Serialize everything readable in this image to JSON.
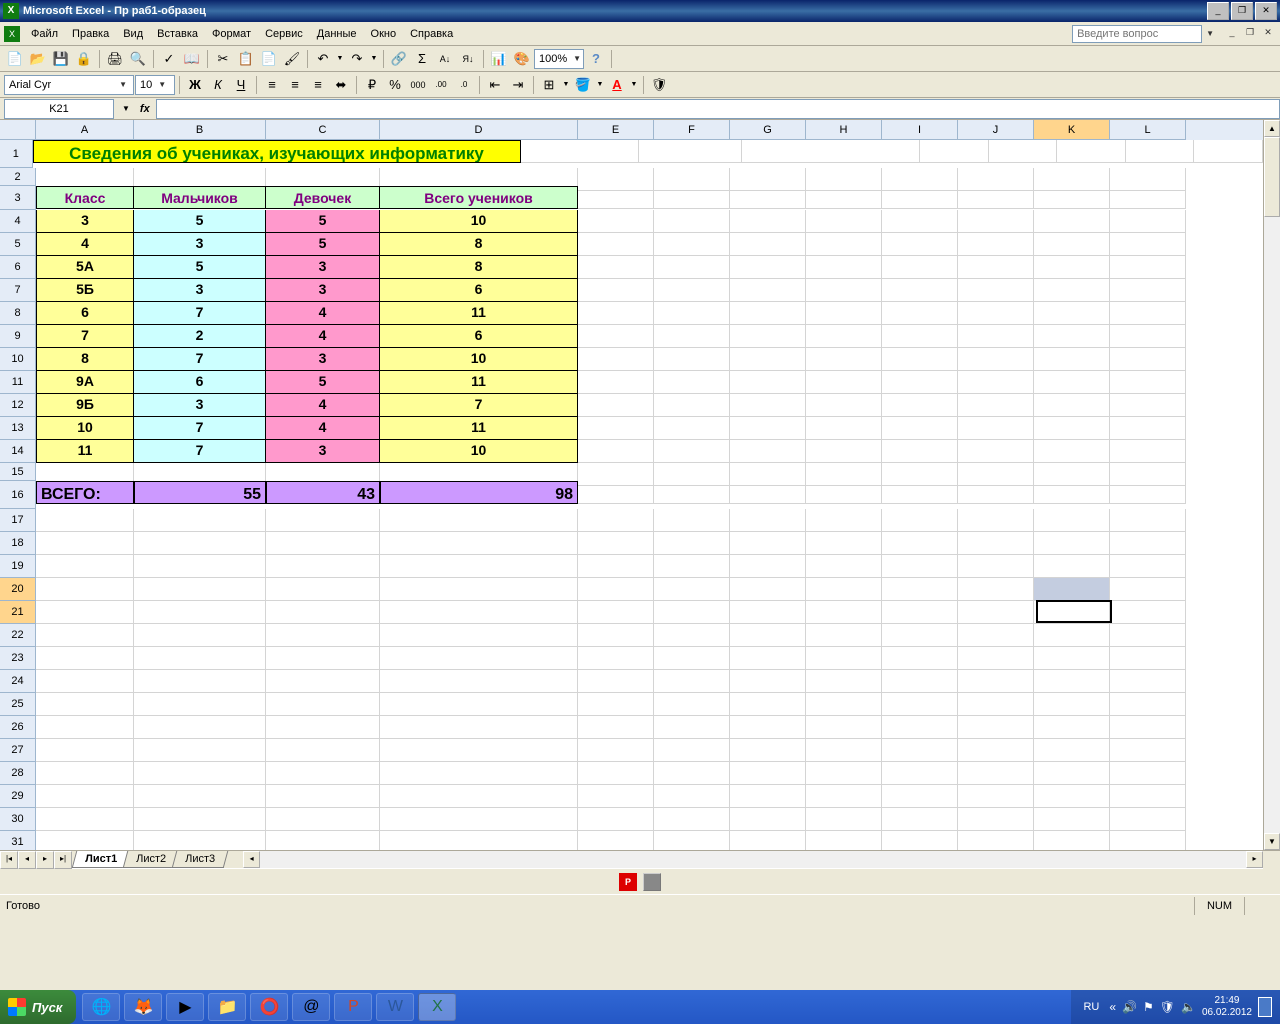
{
  "app": {
    "title": "Microsoft Excel - Пр раб1-образец"
  },
  "menu": {
    "items": [
      "Файл",
      "Правка",
      "Вид",
      "Вставка",
      "Формат",
      "Сервис",
      "Данные",
      "Окно",
      "Справка"
    ],
    "search_placeholder": "Введите вопрос"
  },
  "format": {
    "font": "Arial Cyr",
    "size": "10",
    "zoom": "100%"
  },
  "namebox": "K21",
  "columns": [
    "A",
    "B",
    "C",
    "D",
    "E",
    "F",
    "G",
    "H",
    "I",
    "J",
    "K",
    "L"
  ],
  "rownums": [
    "1",
    "2",
    "3",
    "4",
    "5",
    "6",
    "7",
    "8",
    "9",
    "10",
    "11",
    "12",
    "13",
    "14",
    "15",
    "16",
    "17",
    "18",
    "19",
    "20",
    "21",
    "22",
    "23",
    "24",
    "25",
    "26",
    "27",
    "28",
    "29",
    "30",
    "31"
  ],
  "chart_data": {
    "type": "table",
    "title": "Сведения об учениках, изучающих информатику",
    "headers": [
      "Класс",
      "Мальчиков",
      "Девочек",
      "Всего учеников"
    ],
    "rows": [
      [
        "3",
        "5",
        "5",
        "10"
      ],
      [
        "4",
        "3",
        "5",
        "8"
      ],
      [
        "5А",
        "5",
        "3",
        "8"
      ],
      [
        "5Б",
        "3",
        "3",
        "6"
      ],
      [
        "6",
        "7",
        "4",
        "11"
      ],
      [
        "7",
        "2",
        "4",
        "6"
      ],
      [
        "8",
        "7",
        "3",
        "10"
      ],
      [
        "9А",
        "6",
        "5",
        "11"
      ],
      [
        "9Б",
        "3",
        "4",
        "7"
      ],
      [
        "10",
        "7",
        "4",
        "11"
      ],
      [
        "11",
        "7",
        "3",
        "10"
      ]
    ],
    "total_label": "ВСЕГО:",
    "totals": [
      "55",
      "43",
      "98"
    ]
  },
  "sheets": {
    "tabs": [
      "Лист1",
      "Лист2",
      "Лист3"
    ],
    "active": 0
  },
  "status": {
    "ready": "Готово",
    "num": "NUM"
  },
  "taskbar": {
    "start": "Пуск",
    "lang": "RU",
    "time": "21:49",
    "date": "06.02.2012"
  }
}
